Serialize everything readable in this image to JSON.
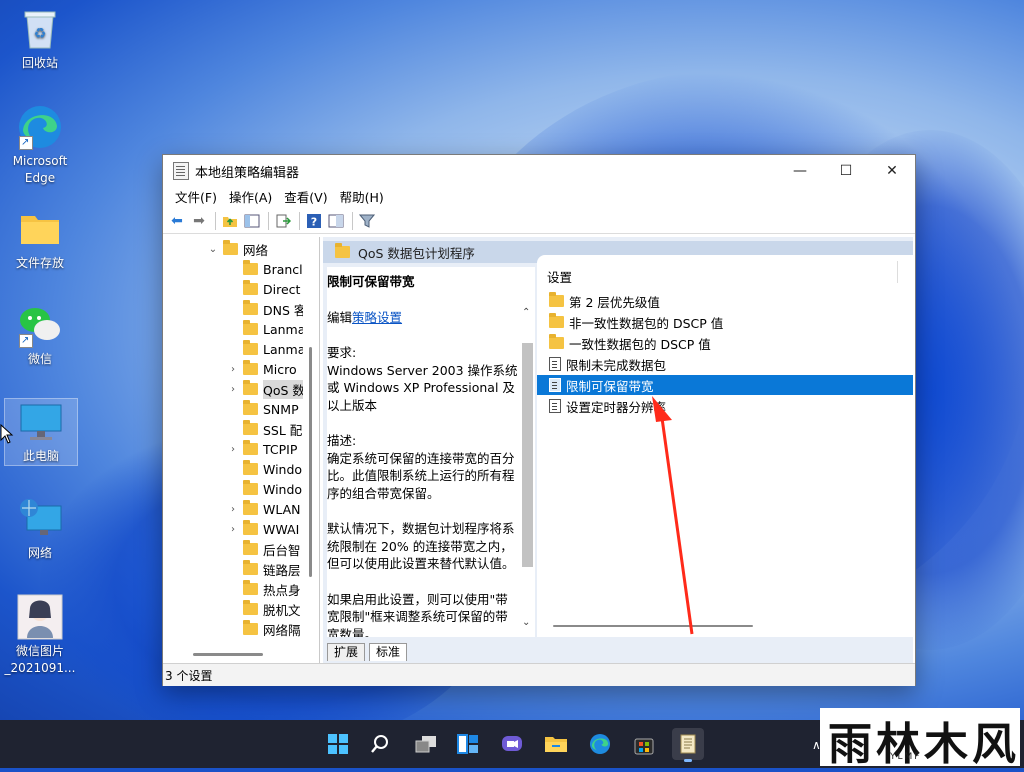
{
  "desktop": {
    "icons": [
      {
        "label": "回收站"
      },
      {
        "label": "Microsoft Edge"
      },
      {
        "label": "文件存放"
      },
      {
        "label": "微信"
      },
      {
        "label": "此电脑"
      },
      {
        "label": "网络"
      },
      {
        "label": "微信图片_2021091..."
      }
    ]
  },
  "window": {
    "title": "本地组策略编辑器",
    "controls": {
      "minimize": "—",
      "maximize": "☐",
      "close": "✕"
    },
    "menu": [
      "文件(F)",
      "操作(A)",
      "查看(V)",
      "帮助(H)"
    ],
    "tree": {
      "root": "网络",
      "items": [
        {
          "label": "Brancl",
          "expandable": false
        },
        {
          "label": "Direct",
          "expandable": false
        },
        {
          "label": "DNS 客",
          "expandable": false
        },
        {
          "label": "Lanma",
          "expandable": false
        },
        {
          "label": "Lanma",
          "expandable": false
        },
        {
          "label": "Micro",
          "expandable": true
        },
        {
          "label": "QoS 数",
          "expandable": true,
          "selected": true
        },
        {
          "label": "SNMP",
          "expandable": false
        },
        {
          "label": "SSL 配",
          "expandable": false
        },
        {
          "label": "TCPIP",
          "expandable": true
        },
        {
          "label": "Windo",
          "expandable": false
        },
        {
          "label": "Windo",
          "expandable": false
        },
        {
          "label": "WLAN",
          "expandable": true
        },
        {
          "label": "WWAI",
          "expandable": true
        },
        {
          "label": "后台智",
          "expandable": false
        },
        {
          "label": "链路层",
          "expandable": false
        },
        {
          "label": "热点身",
          "expandable": false
        },
        {
          "label": "脱机文",
          "expandable": false
        },
        {
          "label": "网络隔",
          "expandable": false
        }
      ]
    },
    "section_header": "QoS 数据包计划程序",
    "description": {
      "title": "限制可保留带宽",
      "edit_prefix": "编辑",
      "edit_link": "策略设置",
      "req_label": "要求:",
      "req_text": "Windows Server 2003 操作系统或 Windows XP Professional 及以上版本",
      "desc_label": "描述:",
      "desc_text1": "确定系统可保留的连接带宽的百分比。此值限制系统上运行的所有程序的组合带宽保留。",
      "desc_text2": "默认情况下，数据包计划程序将系统限制在 20% 的连接带宽之内，但可以使用此设置来替代默认值。",
      "desc_text3": "如果启用此设置，则可以使用\"带宽限制\"框来调整系统可保留的带宽数量。"
    },
    "list": {
      "header": "设置",
      "rows": [
        {
          "label": "第 2 层优先级值",
          "type": "folder"
        },
        {
          "label": "非一致性数据包的 DSCP 值",
          "type": "folder"
        },
        {
          "label": "一致性数据包的 DSCP 值",
          "type": "folder"
        },
        {
          "label": "限制未完成数据包",
          "type": "setting"
        },
        {
          "label": "限制可保留带宽",
          "type": "setting",
          "selected": true
        },
        {
          "label": "设置定时器分辨率",
          "type": "setting"
        }
      ]
    },
    "tabs": [
      "扩展",
      "标准"
    ],
    "status": "3 个设置"
  },
  "watermark": {
    "text": "雨林木风",
    "sub": "YLMF"
  },
  "colors": {
    "selection": "#0a78d7",
    "link": "#0b55c5",
    "arrow": "#ff2a1a",
    "header_band": "#c9d7ea"
  }
}
